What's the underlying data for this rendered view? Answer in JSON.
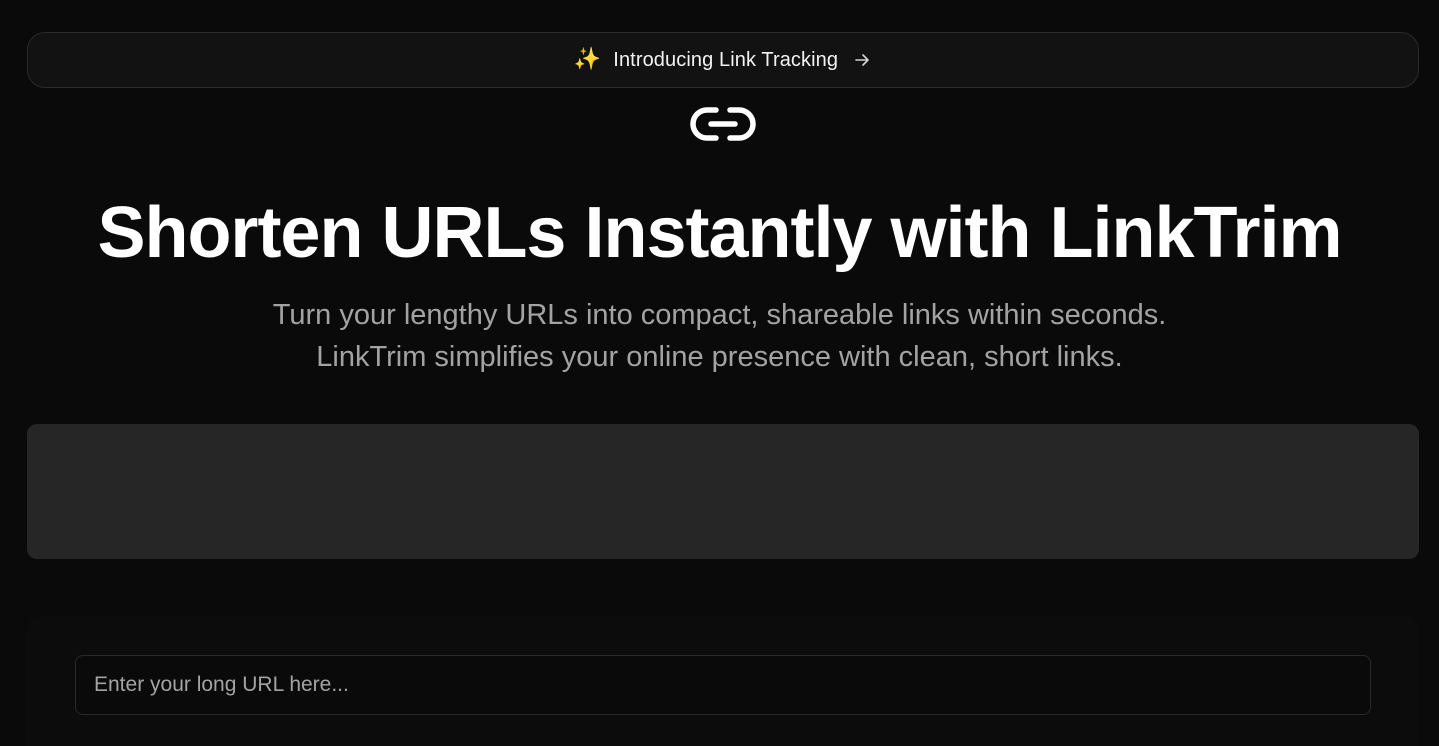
{
  "announcement": {
    "icon": "sparkles-icon",
    "sparkle_glyph": "✨",
    "text": "Introducing Link Tracking",
    "arrow_icon": "arrow-right-icon"
  },
  "logo": {
    "icon": "link-icon"
  },
  "hero": {
    "title": "Shorten URLs Instantly with LinkTrim",
    "subtitle_line1": "Turn your lengthy URLs into compact, shareable links within seconds.",
    "subtitle_line2": "LinkTrim simplifies your online presence with clean, short links."
  },
  "form": {
    "url_placeholder": "Enter your long URL here...",
    "url_value": ""
  },
  "colors": {
    "background": "#0a0a0a",
    "panel": "#262626",
    "border": "#2a2a2a",
    "text_primary": "#ffffff",
    "text_muted": "#a3a3a3",
    "sparkle": "#f5c04a"
  }
}
